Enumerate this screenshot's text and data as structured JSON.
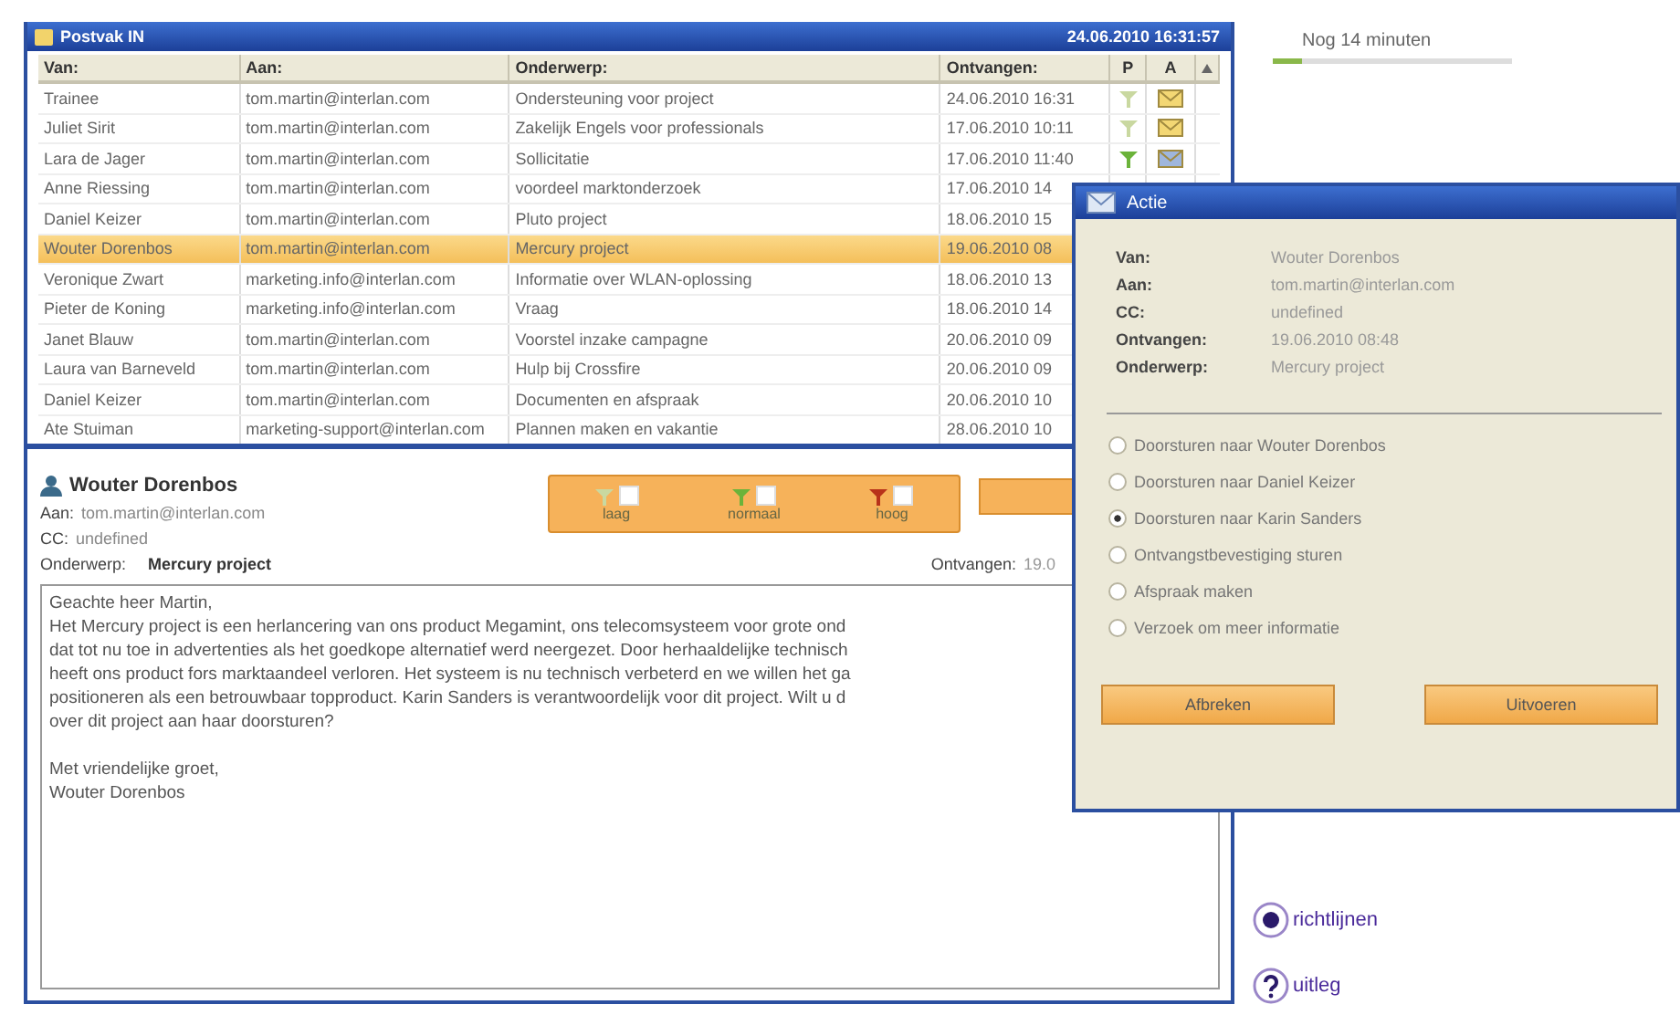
{
  "inbox": {
    "title": "Postvak IN",
    "datetime": "24.06.2010 16:31:57",
    "columns": [
      "Van:",
      "Aan:",
      "Onderwerp:",
      "Ontvangen:",
      "P",
      "A"
    ],
    "rows": [
      {
        "from": "Trainee",
        "to": "tom.martin@interlan.com",
        "subject": "Ondersteuning voor project",
        "received": "24.06.2010 16:31",
        "selected": false,
        "flag": {
          "color": "#c9d8a0"
        },
        "mail": {
          "kind": "closed"
        }
      },
      {
        "from": "Juliet Sirit",
        "to": "tom.martin@interlan.com",
        "subject": "Zakelijk Engels voor professionals",
        "received": "17.06.2010 10:11",
        "selected": false,
        "flag": {
          "color": "#c9d8a0"
        },
        "mail": {
          "kind": "closed"
        }
      },
      {
        "from": "Lara de Jager",
        "to": "tom.martin@interlan.com",
        "subject": "Sollicitatie",
        "received": "17.06.2010 11:40",
        "selected": false,
        "flag": {
          "color": "#6bb33a"
        },
        "mail": {
          "kind": "opened"
        }
      },
      {
        "from": "Anne Riessing",
        "to": "tom.martin@interlan.com",
        "subject": "voordeel marktonderzoek",
        "received": "17.06.2010 14",
        "selected": false
      },
      {
        "from": "Daniel Keizer",
        "to": "tom.martin@interlan.com",
        "subject": "Pluto project",
        "received": "18.06.2010 15",
        "selected": false
      },
      {
        "from": "Wouter Dorenbos",
        "to": "tom.martin@interlan.com",
        "subject": "Mercury project",
        "received": "19.06.2010 08",
        "selected": true
      },
      {
        "from": "Veronique Zwart",
        "to": "marketing.info@interlan.com",
        "subject": "Informatie over WLAN-oplossing",
        "received": "18.06.2010 13",
        "selected": false
      },
      {
        "from": "Pieter de Koning",
        "to": "marketing.info@interlan.com",
        "subject": "Vraag",
        "received": "18.06.2010 14",
        "selected": false
      },
      {
        "from": "Janet Blauw",
        "to": "tom.martin@interlan.com",
        "subject": "Voorstel inzake campagne",
        "received": "20.06.2010 09",
        "selected": false
      },
      {
        "from": "Laura van Barneveld",
        "to": "tom.martin@interlan.com",
        "subject": "Hulp bij Crossfire",
        "received": "20.06.2010 09",
        "selected": false
      },
      {
        "from": "Daniel Keizer",
        "to": "tom.martin@interlan.com",
        "subject": "Documenten en afspraak",
        "received": "20.06.2010 10",
        "selected": false
      },
      {
        "from": "Ate Stuiman",
        "to": "marketing-support@interlan.com",
        "subject": "Plannen maken en vakantie",
        "received": "28.06.2010 10",
        "selected": false
      }
    ]
  },
  "preview": {
    "sender": "Wouter Dorenbos",
    "fields": [
      {
        "label": "Aan:",
        "value": "tom.martin@interlan.com"
      },
      {
        "label": "CC:",
        "value": "undefined"
      }
    ],
    "subject_label": "Onderwerp:",
    "subject": "Mercury project",
    "received_label": "Ontvangen:",
    "received": "19.0",
    "priorities": [
      {
        "label": "laag",
        "color": "#c9d8a0",
        "checked": false
      },
      {
        "label": "normaal",
        "color": "#6bb33a",
        "checked": false
      },
      {
        "label": "hoog",
        "color": "#b8321a",
        "checked": false
      }
    ],
    "body": [
      [
        "Geachte heer Martin,",
        "Het Mercury project is een herlancering van ons product Megamint, ons telecomsysteem voor grote ond",
        "dat tot nu toe in advertenties als het goedkope alternatief werd neergezet. Door herhaaldelijke technisch",
        "heeft ons product fors marktaandeel verloren. Het systeem is nu technisch verbeterd en we willen het ga",
        "positioneren als een betrouwbaar topproduct. Karin Sanders is verantwoordelijk voor dit project. Wilt u d",
        "over dit project aan haar doorsturen?"
      ],
      [
        "Met vriendelijke groet,",
        "Wouter Dorenbos"
      ]
    ]
  },
  "timer": {
    "label": "Nog 14 minuten",
    "level": 0.12
  },
  "links": [
    {
      "label": "richtlijnen",
      "kind": "guidelines"
    },
    {
      "label": "uitleg",
      "kind": "help"
    }
  ],
  "dialog": {
    "title": "Actie",
    "fields": [
      {
        "label": "Van:",
        "value": "Wouter Dorenbos"
      },
      {
        "label": "Aan:",
        "value": "tom.martin@interlan.com"
      },
      {
        "label": "CC:",
        "value": "undefined"
      },
      {
        "label": "Ontvangen:",
        "value": "19.06.2010 08:48"
      },
      {
        "label": "Onderwerp:",
        "value": "Mercury project"
      }
    ],
    "options": [
      {
        "label": "Doorsturen naar Wouter Dorenbos",
        "selected": false
      },
      {
        "label": "Doorsturen naar Daniel Keizer",
        "selected": false
      },
      {
        "label": "Doorsturen naar Karin Sanders",
        "selected": true
      },
      {
        "label": "Ontvangstbevestiging sturen",
        "selected": false
      },
      {
        "label": "Afspraak maken",
        "selected": false
      },
      {
        "label": "Verzoek om meer informatie",
        "selected": false
      }
    ],
    "buttons": [
      "Afbreken",
      "Uitvoeren"
    ]
  }
}
